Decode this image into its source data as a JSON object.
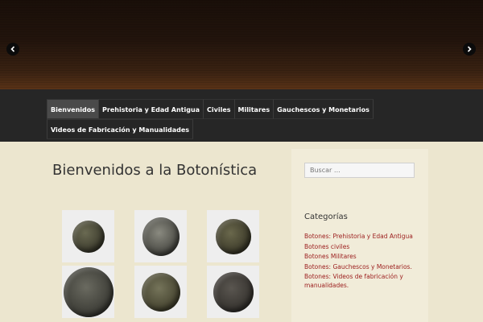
{
  "slider": {
    "prev_icon": "chevron-left-icon",
    "next_icon": "chevron-right-icon"
  },
  "nav": {
    "items": [
      {
        "label": "Bienvenidos",
        "active": true
      },
      {
        "label": "Prehistoria y Edad Antigua"
      },
      {
        "label": "Civiles"
      },
      {
        "label": "Militares"
      },
      {
        "label": "Gauchescos y Monetarios"
      },
      {
        "label": "Videos de Fabricación y Manualidades"
      }
    ]
  },
  "main": {
    "title": "Bienvenidos a la Botonística"
  },
  "sidebar": {
    "search_placeholder": "Buscar …",
    "categories_title": "Categorías",
    "categories": [
      "Botones: Prehistoria y Edad Antigua",
      "Botones civiles",
      "Botones Militares",
      "Botones: Gauchescos y Monetarios.",
      "Botones: Videos de fabricación y manualidades."
    ]
  },
  "colors": {
    "nav_background": "#262626",
    "page_background": "#ece6cf",
    "link_color": "#9b1c1c"
  }
}
